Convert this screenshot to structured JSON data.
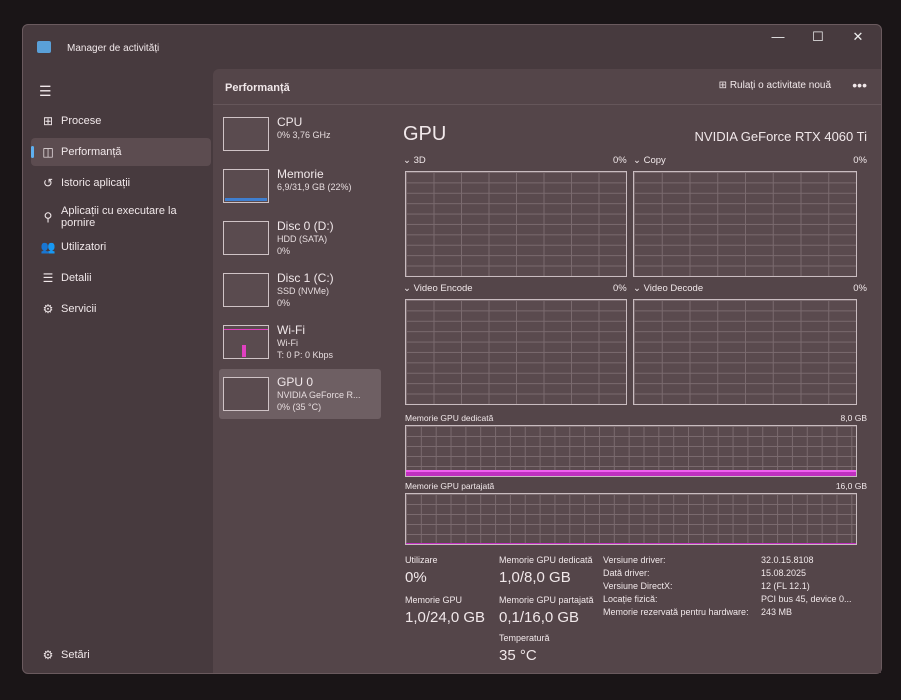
{
  "window": {
    "title": "Manager de activități",
    "minimize": "—",
    "maximize": "☐",
    "close": "✕"
  },
  "sidebar": {
    "items": [
      {
        "label": "Procese",
        "icon": "⊞"
      },
      {
        "label": "Performanță",
        "icon": "◫"
      },
      {
        "label": "Istoric aplicații",
        "icon": "↺"
      },
      {
        "label": "Aplicații cu executare la pornire",
        "icon": "⚲"
      },
      {
        "label": "Utilizatori",
        "icon": "👥"
      },
      {
        "label": "Detalii",
        "icon": "☰"
      },
      {
        "label": "Servicii",
        "icon": "⚙"
      }
    ],
    "settings": "Setări",
    "settings_icon": "⚙"
  },
  "header": {
    "title": "Performanță",
    "run_task": "Rulați o activitate nouă",
    "more": "•••"
  },
  "resources": [
    {
      "name": "CPU",
      "line1": "0% 3,76 GHz",
      "line2": ""
    },
    {
      "name": "Memorie",
      "line1": "6,9/31,9 GB (22%)",
      "line2": ""
    },
    {
      "name": "Disc 0 (D:)",
      "line1": "HDD (SATA)",
      "line2": "0%"
    },
    {
      "name": "Disc 1 (C:)",
      "line1": "SSD (NVMe)",
      "line2": "0%"
    },
    {
      "name": "Wi-Fi",
      "line1": "Wi-Fi",
      "line2": "T: 0 P: 0 Kbps"
    },
    {
      "name": "GPU 0",
      "line1": "NVIDIA GeForce R...",
      "line2": "0% (35 °C)"
    }
  ],
  "memory_fill": 0.22,
  "gpu": {
    "title": "GPU",
    "name": "NVIDIA GeForce RTX 4060 Ti",
    "engines": [
      {
        "name": "3D",
        "value": "0%"
      },
      {
        "name": "Copy",
        "value": "0%"
      },
      {
        "name": "Video Encode",
        "value": "0%"
      },
      {
        "name": "Video Decode",
        "value": "0%"
      }
    ],
    "dedicated": {
      "label": "Memorie GPU dedicată",
      "max": "8,0 GB",
      "fill": 0.125
    },
    "shared": {
      "label": "Memorie GPU partajată",
      "max": "16,0 GB",
      "fill": 0.006
    },
    "stats": {
      "util_label": "Utilizare",
      "util": "0%",
      "mem_label": "Memorie GPU",
      "mem": "1,0/24,0 GB",
      "ded_label": "Memorie GPU dedicată",
      "ded": "1,0/8,0 GB",
      "sh_label": "Memorie GPU partajată",
      "sh": "0,1/16,0 GB",
      "temp_label": "Temperatură",
      "temp": "35 °C"
    },
    "info": [
      [
        "Versiune driver:",
        "32.0.15.8108"
      ],
      [
        "Dată driver:",
        "15.08.2025"
      ],
      [
        "Versiune DirectX:",
        "12 (FL 12.1)"
      ],
      [
        "Locație fizică:",
        "PCI bus 45, device 0..."
      ],
      [
        "Memorie rezervată pentru hardware:",
        "243 MB"
      ]
    ]
  }
}
